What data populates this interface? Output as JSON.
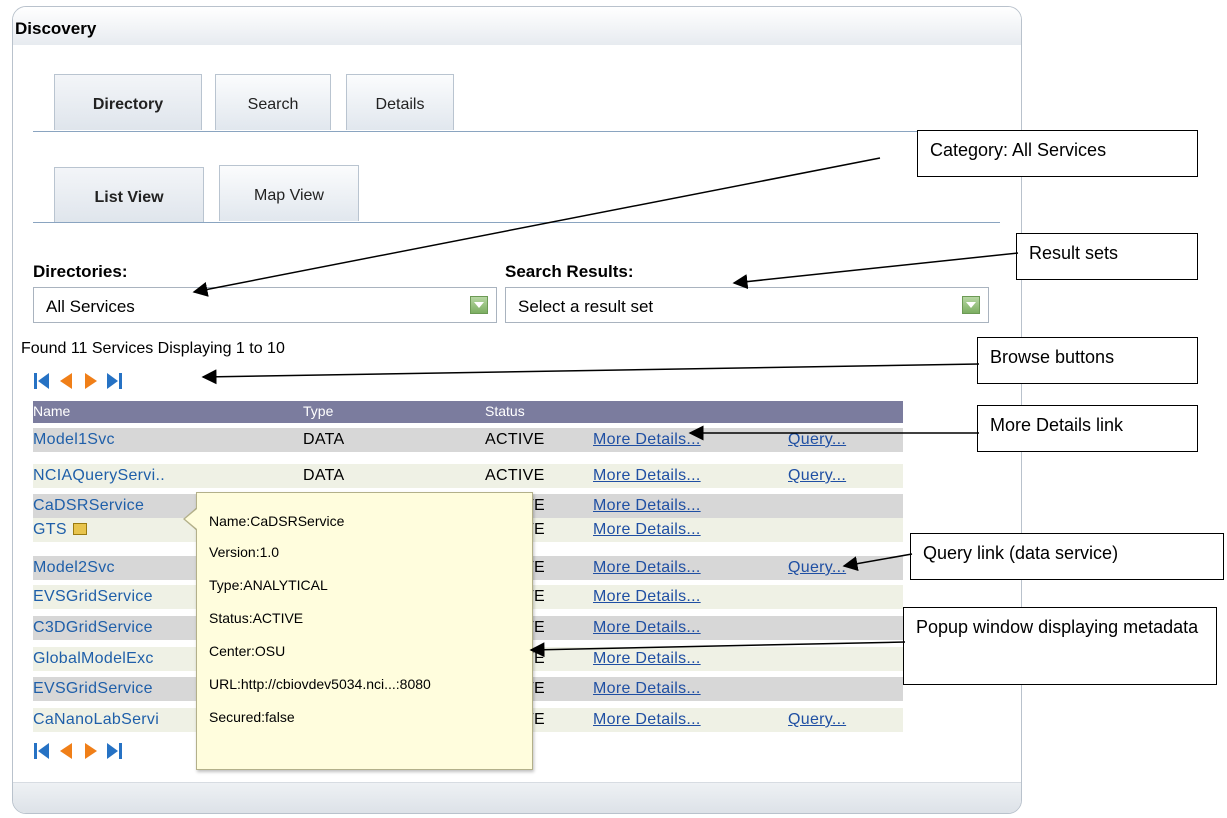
{
  "panel": {
    "title": "Discovery"
  },
  "tabs": {
    "top": [
      "Directory",
      "Search",
      "Details"
    ],
    "sub": [
      "List View",
      "Map View"
    ]
  },
  "directories": {
    "label": "Directories:",
    "value": "All Services"
  },
  "search_results": {
    "label": "Search Results:",
    "value": "Select a result set"
  },
  "found_text": "Found 11 Services Displaying 1 to 10",
  "table": {
    "headers": [
      "Name",
      "Type",
      "Status"
    ],
    "rows": [
      {
        "name": "Model1Svc",
        "type": "DATA",
        "status": "ACTIVE",
        "details": "More Details...",
        "query": "Query..."
      },
      {
        "name": "NCIAQueryServi..",
        "type": "DATA",
        "status": "ACTIVE",
        "details": "More Details...",
        "query": "Query..."
      },
      {
        "name": "CaDSRService",
        "type": "",
        "status": "VE",
        "details": "More Details...",
        "query": ""
      },
      {
        "name": "GTS",
        "type": "",
        "status": "VE",
        "details": "More Details...",
        "query": ""
      },
      {
        "name": "Model2Svc",
        "type": "",
        "status": "VE",
        "details": "More Details...",
        "query": "Query..."
      },
      {
        "name": "EVSGridService",
        "type": "",
        "status": "VE",
        "details": "More Details...",
        "query": ""
      },
      {
        "name": "C3DGridService",
        "type": "",
        "status": "VE",
        "details": "More Details...",
        "query": ""
      },
      {
        "name": "GlobalModelExc",
        "type": "",
        "status": "VE",
        "details": "More Details...",
        "query": ""
      },
      {
        "name": "EVSGridService",
        "type": "",
        "status": "VE",
        "details": "More Details...",
        "query": ""
      },
      {
        "name": "CaNanoLabServi",
        "type": "",
        "status": "VE",
        "details": "More Details...",
        "query": "Query..."
      }
    ]
  },
  "popup": [
    "Name:CaDSRService",
    "Version:1.0",
    "Type:ANALYTICAL",
    "Status:ACTIVE",
    "Center:OSU",
    "URL:http://cbiovdev5034.nci...:8080",
    "Secured:false"
  ],
  "callouts": {
    "category": "Category: All Services",
    "result_sets": "Result sets",
    "browse": "Browse buttons",
    "more_details": "More Details link",
    "query": "Query link (data service)",
    "popup": "Popup window displaying metadata"
  },
  "colors": {
    "header": "#7b7c9e",
    "odd": "#d7d7d7",
    "even": "#eff1e5",
    "link": "#1f4fa3",
    "popup": "#fffddd"
  },
  "icons": {
    "first": "first-page-icon",
    "prev": "prev-page-icon",
    "next": "next-page-icon",
    "last": "last-page-icon",
    "lock": "lock-icon"
  }
}
